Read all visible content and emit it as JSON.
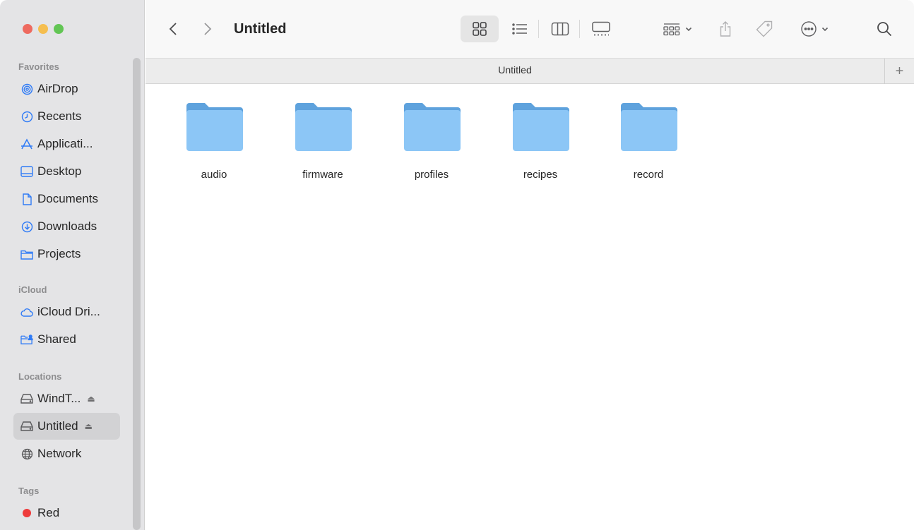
{
  "window": {
    "title": "Untitled",
    "tab_title": "Untitled"
  },
  "sidebar": {
    "sections": {
      "favorites": "Favorites",
      "icloud": "iCloud",
      "locations": "Locations",
      "tags": "Tags"
    },
    "favorites": [
      {
        "label": "AirDrop",
        "icon": "airdrop-icon"
      },
      {
        "label": "Recents",
        "icon": "clock-icon"
      },
      {
        "label": "Applicati...",
        "icon": "applications-icon"
      },
      {
        "label": "Desktop",
        "icon": "desktop-icon"
      },
      {
        "label": "Documents",
        "icon": "document-icon"
      },
      {
        "label": "Downloads",
        "icon": "download-icon"
      },
      {
        "label": "Projects",
        "icon": "folder-icon"
      }
    ],
    "icloud": [
      {
        "label": "iCloud Dri...",
        "icon": "cloud-icon"
      },
      {
        "label": "Shared",
        "icon": "shared-folder-icon"
      }
    ],
    "locations": [
      {
        "label": "WindT...",
        "icon": "drive-icon",
        "eject": "⏏"
      },
      {
        "label": "Untitled",
        "icon": "drive-icon",
        "eject": "⏏",
        "selected": true
      },
      {
        "label": "Network",
        "icon": "network-icon"
      }
    ],
    "tags": [
      {
        "label": "Red",
        "color": "#ee3b3b"
      }
    ]
  },
  "toolbar": {
    "back": "‹",
    "forward": "›",
    "plus": "+"
  },
  "files": [
    {
      "name": "audio"
    },
    {
      "name": "firmware"
    },
    {
      "name": "profiles"
    },
    {
      "name": "recipes"
    },
    {
      "name": "record"
    }
  ],
  "colors": {
    "folder_body": "#8cc6f6",
    "folder_tab": "#5ea2dd",
    "accent": "#2f7bf6"
  }
}
